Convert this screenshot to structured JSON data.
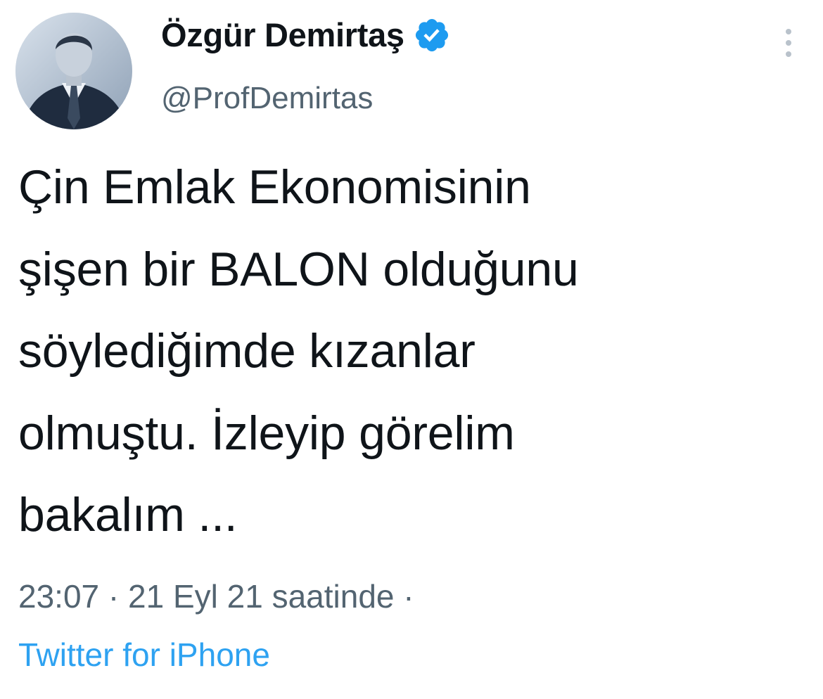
{
  "author": {
    "display_name": "Özgür Demirtaş",
    "handle": "@ProfDemirtas",
    "verified": true,
    "avatar_icon": "profile-photo"
  },
  "tweet": {
    "lines": [
      "Çin Emlak Ekonomisinin",
      "şişen bir BALON olduğunu",
      "söylediğimde kızanlar",
      "olmuştu. İzleyip görelim",
      "bakalım ..."
    ]
  },
  "meta": {
    "time": "23:07",
    "separator": "·",
    "date": "21 Eyl 21 saatinde",
    "trailing_separator": "·",
    "source": "Twitter for iPhone"
  },
  "icons": {
    "verified": "verified-badge-icon",
    "more": "more-options-icon"
  },
  "colors": {
    "text": "#0f1419",
    "secondary": "#536471",
    "link": "#1d9bf0",
    "verified": "#1d9bf0"
  }
}
